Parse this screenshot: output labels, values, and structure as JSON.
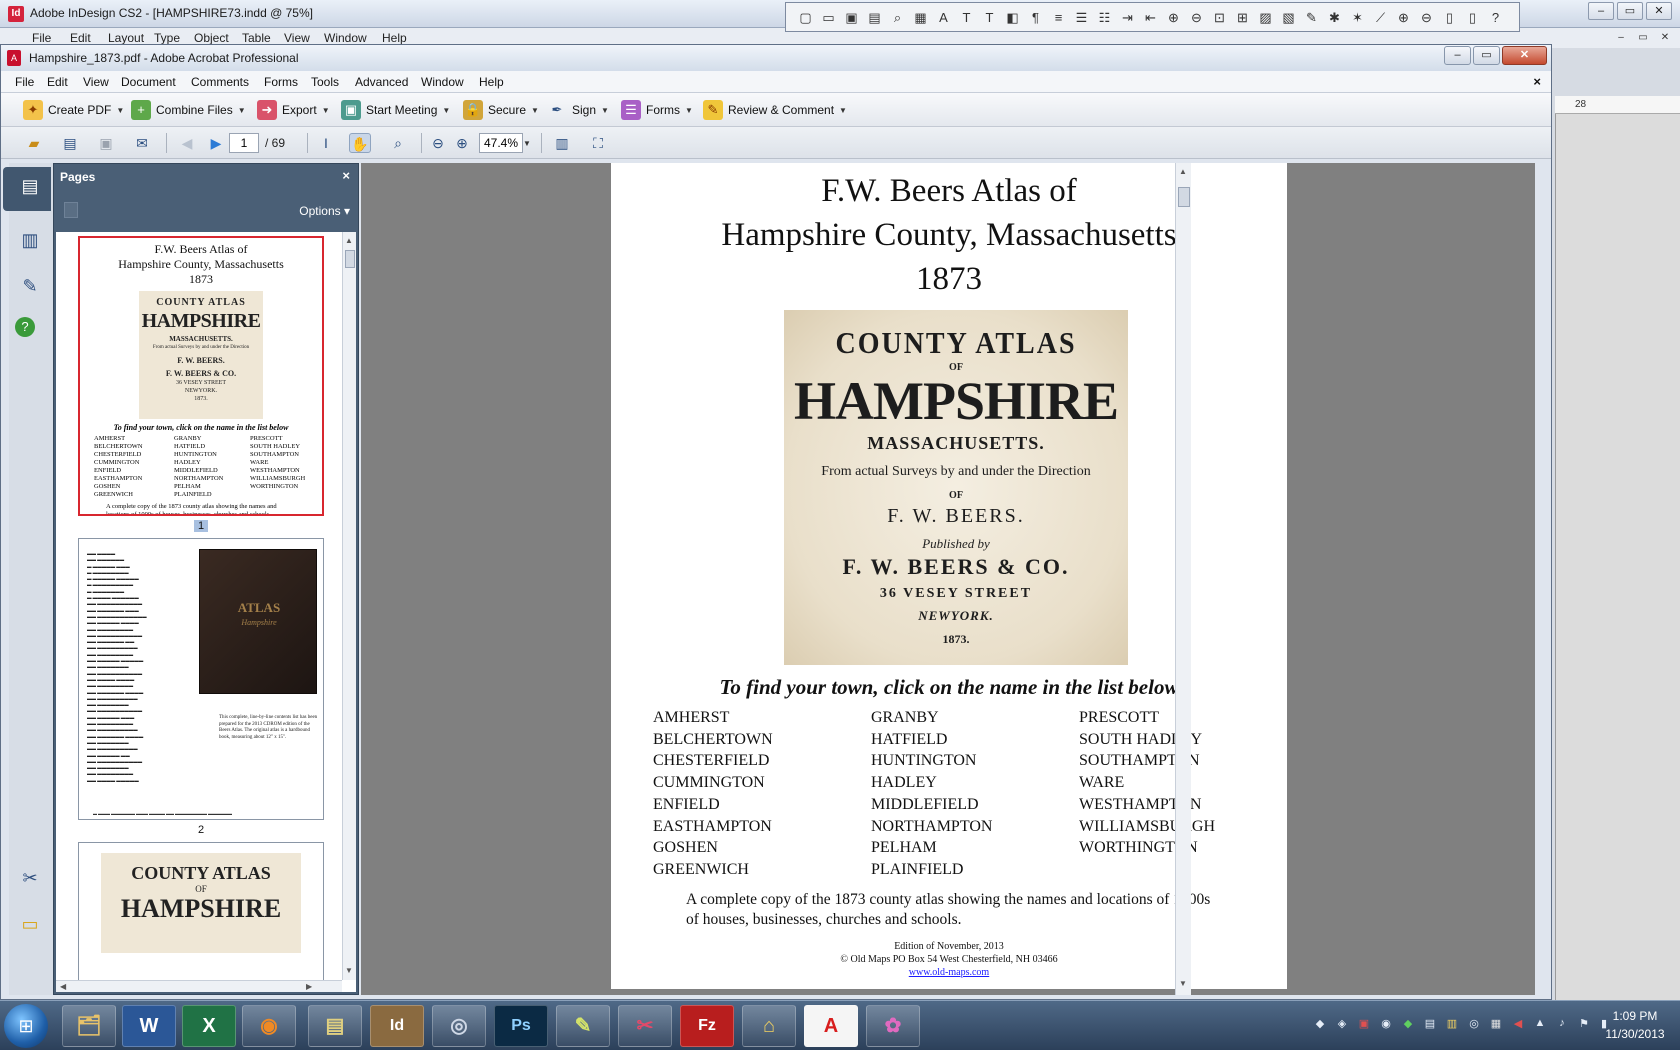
{
  "indesign": {
    "title": "Adobe InDesign CS2 - [HAMPSHIRE73.indd @ 75%]",
    "menu": [
      "File",
      "Edit",
      "Layout",
      "Type",
      "Object",
      "Table",
      "View",
      "Window",
      "Help"
    ],
    "ruler_value": "28"
  },
  "acrobat": {
    "title": "Hampshire_1873.pdf - Adobe Acrobat Professional",
    "menu": [
      "File",
      "Edit",
      "View",
      "Document",
      "Comments",
      "Forms",
      "Tools",
      "Advanced",
      "Window",
      "Help"
    ],
    "tasks": [
      {
        "label": "Create PDF",
        "icon": "create-pdf-icon"
      },
      {
        "label": "Combine Files",
        "icon": "combine-files-icon"
      },
      {
        "label": "Export",
        "icon": "export-icon"
      },
      {
        "label": "Start Meeting",
        "icon": "meeting-icon"
      },
      {
        "label": "Secure",
        "icon": "lock-icon"
      },
      {
        "label": "Sign",
        "icon": "pen-icon"
      },
      {
        "label": "Forms",
        "icon": "forms-icon"
      },
      {
        "label": "Review & Comment",
        "icon": "comment-icon"
      }
    ],
    "nav": {
      "current_page": "1",
      "total_pages": "/ 69",
      "zoom": "47.4%"
    },
    "pages_panel": {
      "title": "Pages",
      "options_label": "Options",
      "thumb_labels": [
        "1",
        "2"
      ]
    }
  },
  "document": {
    "title_lines": [
      "F.W. Beers Atlas of",
      "Hampshire County, Massachusetts",
      "1873"
    ],
    "cover": {
      "line1": "COUNTY ATLAS",
      "line1b": "OF",
      "line2": "HAMPSHIRE",
      "line3": "MASSACHUSETTS.",
      "line4": "From actual Surveys by and under the Direction",
      "line5": "OF",
      "line6": "F. W. BEERS.",
      "line7": "Published by",
      "line8": "F. W. BEERS & CO.",
      "line9": "36 VESEY STREET",
      "line10": "NEWYORK.",
      "line11": "1873."
    },
    "find_text": "To find your town, click on the name in the list below",
    "towns_col1": [
      "AMHERST",
      "BELCHERTOWN",
      "CHESTERFIELD",
      "CUMMINGTON",
      "ENFIELD",
      "EASTHAMPTON",
      "GOSHEN",
      "GREENWICH"
    ],
    "towns_col2": [
      "GRANBY",
      "HATFIELD",
      "HUNTINGTON",
      "HADLEY",
      "MIDDLEFIELD",
      "NORTHAMPTON",
      "PELHAM",
      "PLAINFIELD"
    ],
    "towns_col3": [
      "PRESCOTT",
      "SOUTH HADLEY",
      "SOUTHAMPTON",
      "WARE",
      "WESTHAMPTON",
      "WILLIAMSBURGH",
      "WORTHINGTON"
    ],
    "description": "A complete copy of the 1873 county atlas showing the names and locations of 1000s of  houses, businesses, churches and schools.",
    "edition": "Edition of November, 2013",
    "copyright": "© Old Maps  PO Box 54   West Chesterfield, NH 03466",
    "link": "www.old-maps.com"
  },
  "thumb2": {
    "book_title": "ATLAS",
    "book_sub": "Hampshire",
    "note": "This complete, line-by-line contents list has been prepared for the 2013 CDROM edition of the Beers Atlas. The original atlas is a hardbound book, measuring about 12\" x 15\"."
  },
  "thumb3": {
    "line1": "COUNTY ATLAS",
    "line2": "OF",
    "line3": "HAMPSHIRE"
  },
  "taskbar": {
    "apps": [
      {
        "icon": "explorer-icon",
        "glyph": "🗂"
      },
      {
        "icon": "word-icon",
        "glyph": "W"
      },
      {
        "icon": "excel-icon",
        "glyph": "X"
      },
      {
        "icon": "firefox-icon",
        "glyph": "◉"
      },
      {
        "icon": "folder-icon",
        "glyph": "▤"
      },
      {
        "icon": "indesign-icon",
        "glyph": "Id"
      },
      {
        "icon": "camera-icon",
        "glyph": "◎"
      },
      {
        "icon": "photoshop-icon",
        "glyph": "Ps"
      },
      {
        "icon": "chart-app-icon",
        "glyph": "✎"
      },
      {
        "icon": "scissors-icon",
        "glyph": "✂"
      },
      {
        "icon": "filezilla-icon",
        "glyph": "Fz"
      },
      {
        "icon": "network-icon",
        "glyph": "⌂"
      },
      {
        "icon": "acrobat-icon",
        "glyph": "A"
      },
      {
        "icon": "butterfly-icon",
        "glyph": "✿"
      }
    ],
    "time": "1:09 PM",
    "date": "11/30/2013"
  },
  "colors": {
    "doc_background": "#808080",
    "panel_background": "#4a5f76",
    "selected_thumb_border": "#d8262f",
    "link": "#1a1aff"
  }
}
